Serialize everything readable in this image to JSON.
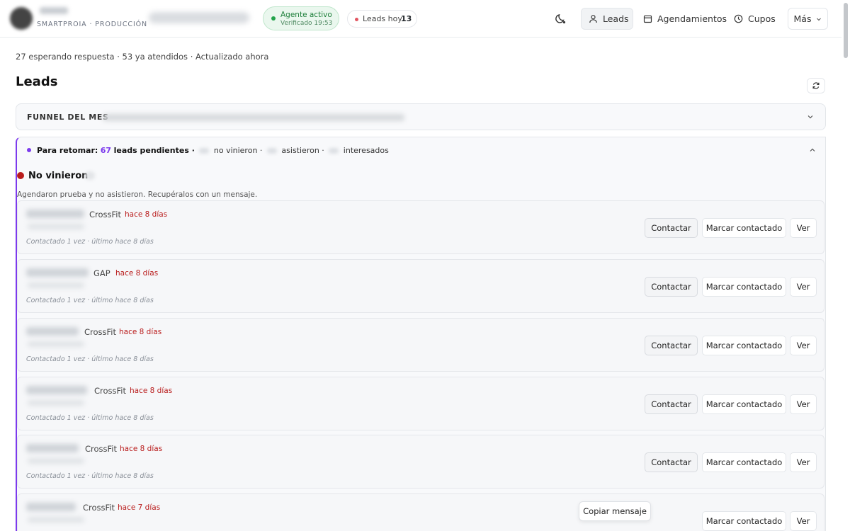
{
  "header": {
    "brand_sub": "SMARTPROIA · PRODUCCIÓN",
    "agent": {
      "title": "Agente activo",
      "subtitle": "Verificado 19:53",
      "status_color": "#22a34a"
    },
    "leads_today": {
      "label": "Leads hoy",
      "count": "13"
    },
    "nav": {
      "leads": "Leads",
      "agenda": "Agendamientos",
      "cupos": "Cupos",
      "more": "Más"
    }
  },
  "summary": "27 esperando respuesta · 53 ya atendidos · Actualizado ahora",
  "page_title": "Leads",
  "funnel": {
    "label": "FUNNEL DEL MES"
  },
  "retomar": {
    "prefix": "Para retomar:",
    "count": "67",
    "pending": "leads pendientes ·",
    "no_vinieron": "no vinieron ·",
    "asistieron": "asistieron ·",
    "interesados": "interesados",
    "accent": "#7c3aed"
  },
  "section": {
    "title": "No vinieron",
    "description": "Agendaron prueba y no asistieron. Recupéralos con un mensaje."
  },
  "actions": {
    "contactar": "Contactar",
    "marcar": "Marcar contactado",
    "ver": "Ver",
    "copiar": "Copiar mensaje"
  },
  "leads": [
    {
      "type": "CrossFit",
      "age": "hace 8 días",
      "contact": "Contactado 1 vez · último hace 8 días"
    },
    {
      "type": "GAP",
      "age": "hace 8 días",
      "contact": "Contactado 1 vez · último hace 8 días"
    },
    {
      "type": "CrossFit",
      "age": "hace 8 días",
      "contact": "Contactado 1 vez · último hace 8 días"
    },
    {
      "type": "CrossFit",
      "age": "hace 8 días",
      "contact": "Contactado 1 vez · último hace 8 días"
    },
    {
      "type": "CrossFit",
      "age": "hace 8 días",
      "contact": "Contactado 1 vez · último hace 8 días"
    },
    {
      "type": "CrossFit",
      "age": "hace 7 días",
      "contact": ""
    }
  ]
}
